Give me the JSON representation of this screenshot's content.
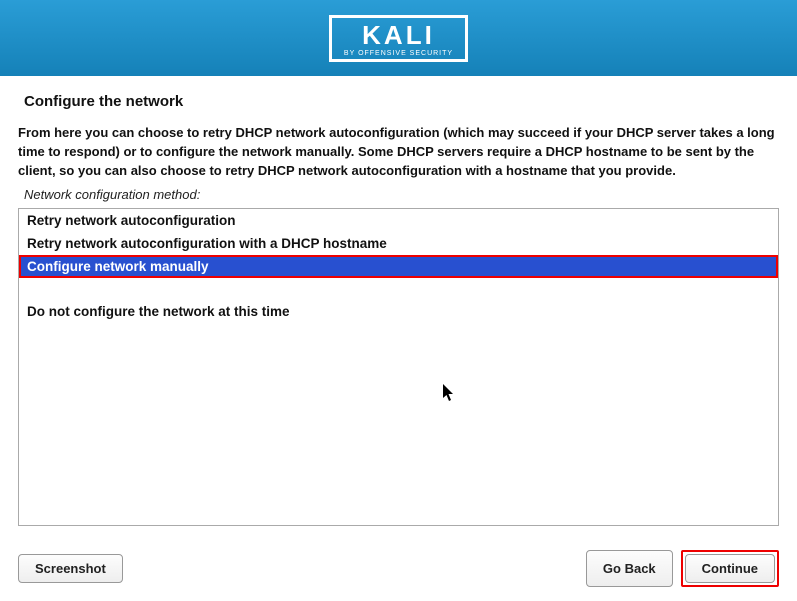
{
  "brand": {
    "name": "KALI",
    "tagline": "BY OFFENSIVE SECURITY"
  },
  "page_title": "Configure the network",
  "description": "From here you can choose to retry DHCP network autoconfiguration (which may succeed if your DHCP server takes a long time to respond) or to configure the network manually. Some DHCP servers require a DHCP hostname to be sent by the client, so you can also choose to retry DHCP network autoconfiguration with a hostname that you provide.",
  "method_label": "Network configuration method:",
  "options": {
    "retry_auto": "Retry network autoconfiguration",
    "retry_auto_hostname": "Retry network autoconfiguration with a DHCP hostname",
    "configure_manually": "Configure network manually",
    "do_not_configure": "Do not configure the network at this time"
  },
  "buttons": {
    "screenshot": "Screenshot",
    "go_back": "Go Back",
    "continue": "Continue"
  }
}
